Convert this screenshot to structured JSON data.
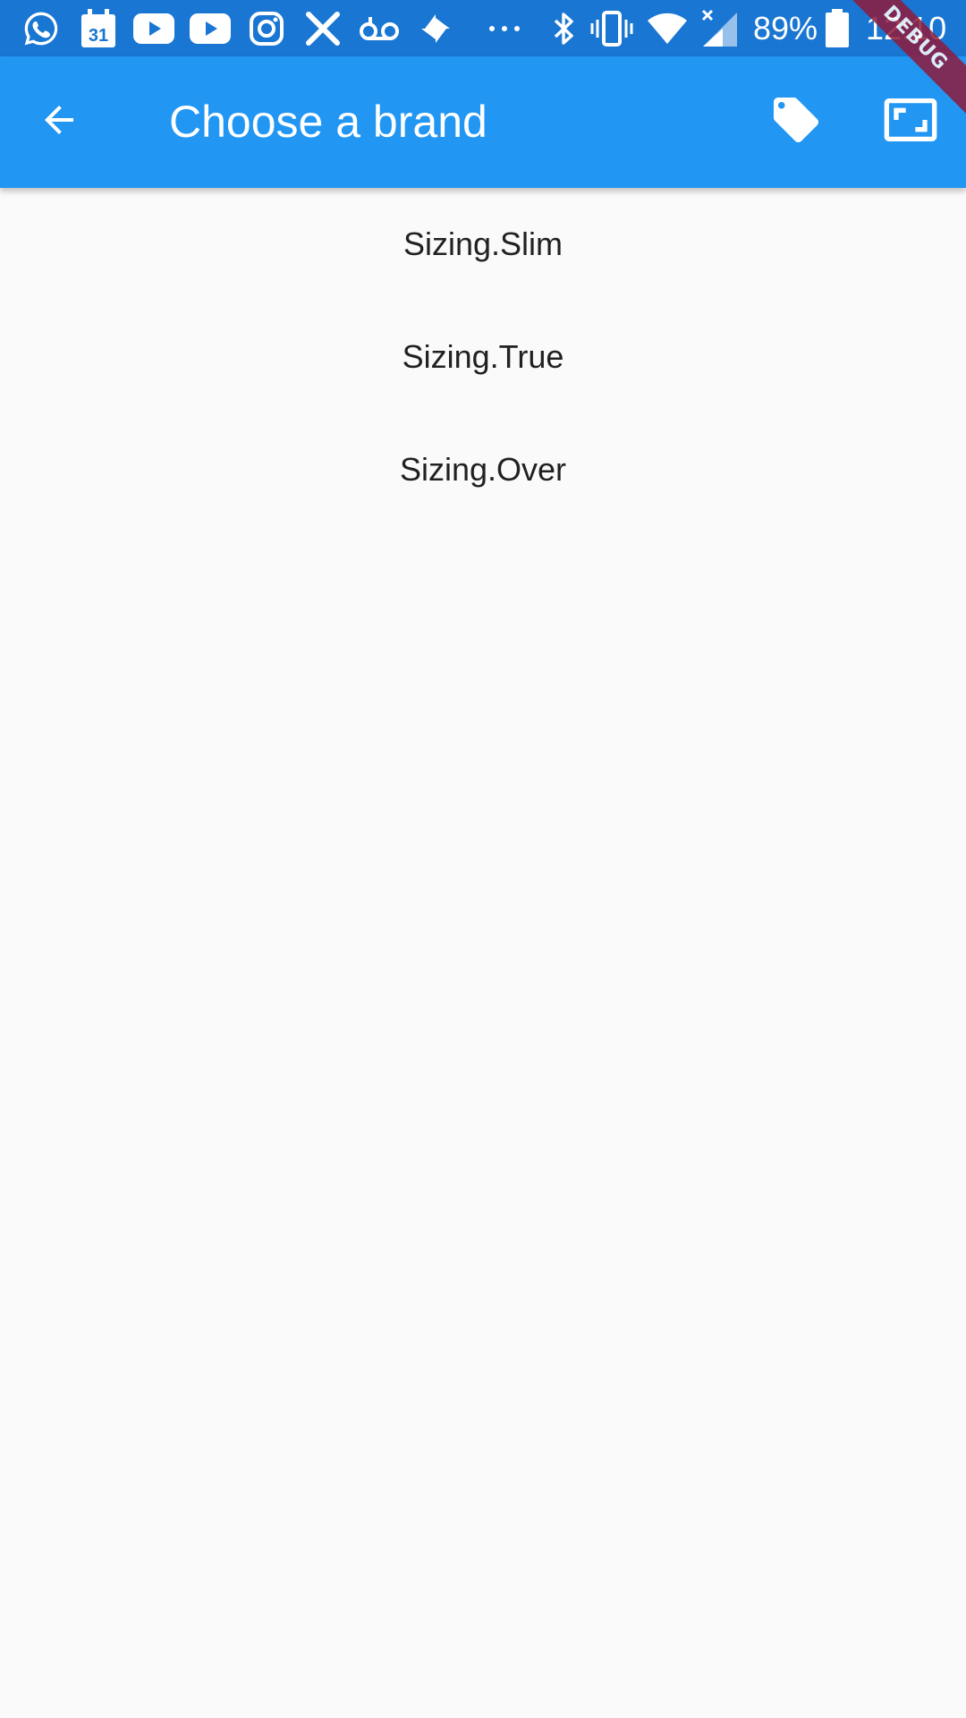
{
  "status_bar": {
    "icons": [
      "whatsapp-icon",
      "calendar-icon",
      "youtube-icon",
      "youtube-icon",
      "instagram-icon",
      "x-app-icon",
      "voicemail-icon",
      "pinwheel-icon",
      "more-dots-icon",
      "bluetooth-icon",
      "vibrate-icon",
      "wifi-icon",
      "signal-icon",
      "battery-icon"
    ],
    "calendar_day": "31",
    "battery": "89%",
    "time": "12:10",
    "bg_color": "#1976D2"
  },
  "app_bar": {
    "title": "Choose a brand",
    "back_icon": "arrow-back-icon",
    "actions": [
      "tag-icon",
      "aspect-ratio-icon"
    ],
    "color": "#2196F3"
  },
  "options": [
    {
      "label": "Sizing.Slim"
    },
    {
      "label": "Sizing.True"
    },
    {
      "label": "Sizing.Over"
    }
  ],
  "debug_banner": "DEBUG"
}
